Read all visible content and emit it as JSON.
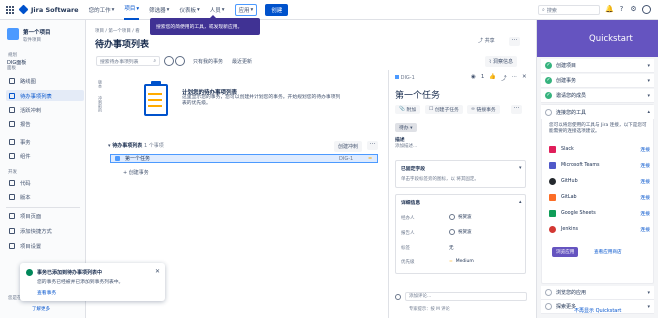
{
  "topbar": {
    "logo_text": "Jira Software",
    "nav": [
      "您的工作",
      "项目",
      "筛选器",
      "仪表板",
      "人员",
      "应用"
    ],
    "create_label": "创建",
    "search_placeholder": "搜索"
  },
  "tooltip": {
    "text": "搜索您的简便用的工具，或发现新应用。"
  },
  "sidebar": {
    "project_name": "第一个项目",
    "project_type": "软件项目",
    "section_planning": "规划",
    "board_name": "DIG面板",
    "board_type": "面板",
    "items": [
      {
        "label": "路线图"
      },
      {
        "label": "待办事项列表"
      },
      {
        "label": "活跃冲刺"
      },
      {
        "label": "报告"
      },
      {
        "label": "事务"
      },
      {
        "label": "组件"
      }
    ],
    "section_dev": "开发",
    "dev_items": [
      {
        "label": "代码"
      },
      {
        "label": "版本"
      }
    ],
    "bottom_items": [
      {
        "label": "项目页面"
      },
      {
        "label": "添加快捷方式"
      },
      {
        "label": "项目设置"
      }
    ],
    "footer_text": "您是在",
    "footer_link": "了解更多"
  },
  "main": {
    "breadcrumb": "项目 / 第一个项目 / 看",
    "title": "待办事项列表",
    "share_label": "共享",
    "insights_label": "洞察信息",
    "search_placeholder": "搜索待办事项列表",
    "filters": [
      "只有我的事务",
      "最近更新"
    ],
    "vert_labels": [
      "版本",
      "冲刺前的"
    ],
    "empty_title": "计划您的待办事项列表",
    "empty_desc": "这里显示您的事务，您可以创建并计划您的事务。开始规划您的待办事项列表的优先级。",
    "backlog_label": "待办事项列表",
    "backlog_count": "1 个事项",
    "create_sprint": "创建冲刺",
    "issue": {
      "title": "第一个任务",
      "key": "DIG-1"
    },
    "create_issue": "+ 创建事务"
  },
  "detail": {
    "key": "DIG-1",
    "watch_count": "1",
    "title": "第一个任务",
    "buttons": [
      "附加",
      "创建子任务",
      "链接事务"
    ],
    "status": "待办",
    "desc_label": "描述",
    "desc_placeholder": "添加描述...",
    "pinned_label": "已固定字段",
    "pinned_hint": "单击字段标签旁的图标，以 将其固定。",
    "details_label": "详细信息",
    "fields": [
      {
        "name": "经办人",
        "value": "祝贺波"
      },
      {
        "name": "报告人",
        "value": "祝贺波"
      },
      {
        "name": "标签",
        "value": "无"
      },
      {
        "name": "优先级",
        "value": "Medium"
      }
    ],
    "comment_placeholder": "添加评论...",
    "shortcut_hint": "专家提示：按 M 评论"
  },
  "toast": {
    "title": "事务已添加到待办事项列表中",
    "message": "您的事务已经被并已添加到事务列表中。",
    "link": "查看事务"
  },
  "quickstart": {
    "title": "Quickstart",
    "steps": [
      {
        "label": "创建项目",
        "done": true
      },
      {
        "label": "创建事务",
        "done": true
      },
      {
        "label": "邀请您的成员",
        "done": true
      },
      {
        "label": "连接您的工具",
        "done": false
      }
    ],
    "intro": "您可以将您使用的工具与 Jira 连接，以下是您可能需要的连接选项建议。",
    "integrations": [
      {
        "name": "Slack",
        "link": "连接",
        "color": "#e01e5a"
      },
      {
        "name": "Microsoft Teams",
        "link": "连接",
        "color": "#5059c9"
      },
      {
        "name": "GitHub",
        "link": "连接",
        "color": "#24292e"
      },
      {
        "name": "GitLab",
        "link": "连接",
        "color": "#fc6d26"
      },
      {
        "name": "Google Sheets",
        "link": "连接",
        "color": "#0f9d58"
      },
      {
        "name": "Jenkins",
        "link": "连接",
        "color": "#d33833"
      }
    ],
    "explore_btn": "浏览应用",
    "more_link": "查看应用商店",
    "bottom_steps": [
      {
        "label": "浏览您的应用"
      },
      {
        "label": "探索更多"
      }
    ],
    "footer": "不再显示 Quickstart"
  }
}
